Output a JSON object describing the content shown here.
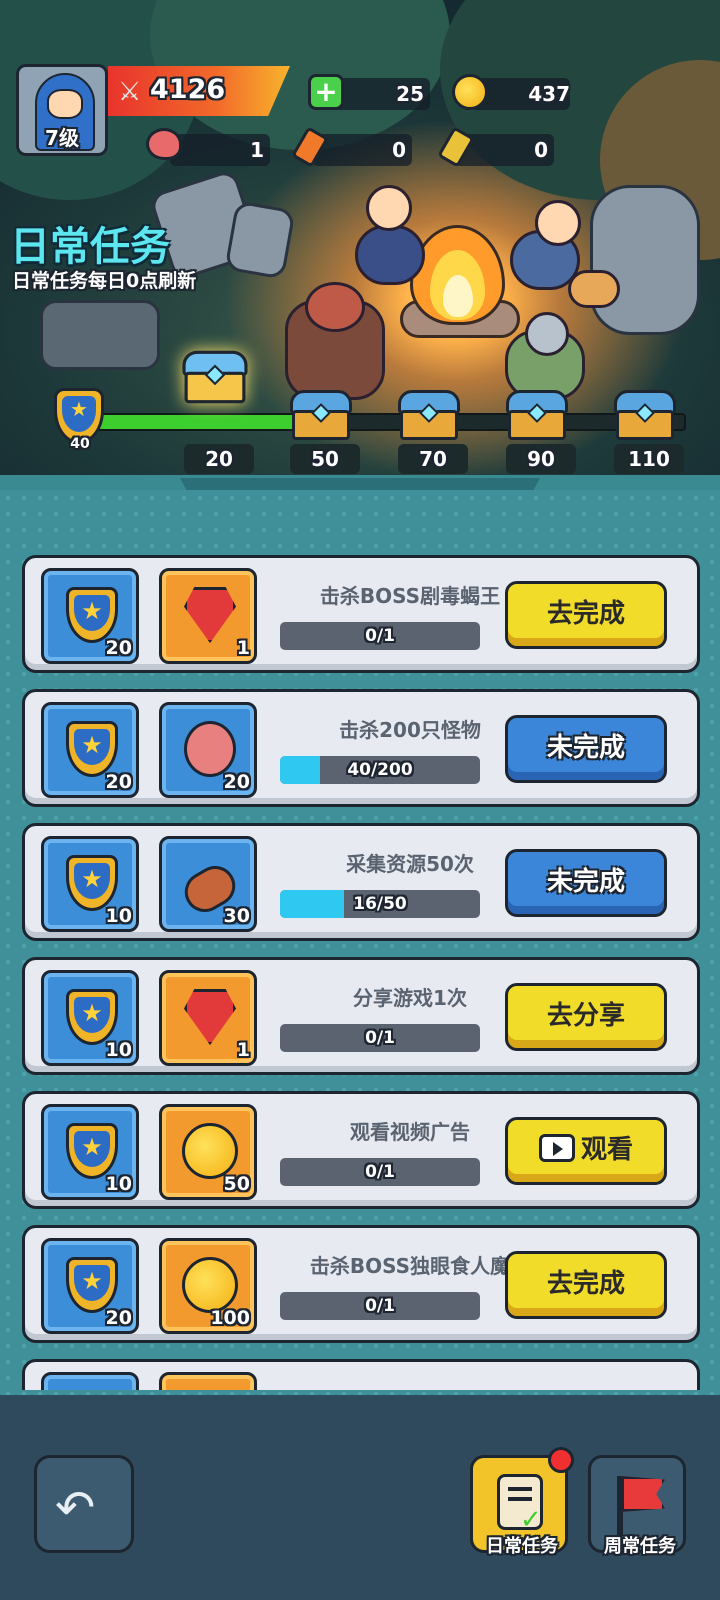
{
  "player": {
    "level_label": "7级",
    "power": "4126"
  },
  "resources": [
    {
      "name": "gem",
      "value": "25"
    },
    {
      "name": "coin",
      "value": "437"
    },
    {
      "name": "meat",
      "value": "1"
    },
    {
      "name": "red-ticket",
      "value": "0"
    },
    {
      "name": "blue-ticket",
      "value": "0"
    }
  ],
  "header": {
    "title": "日常任务",
    "subtitle": "日常任务每日0点刷新"
  },
  "activity": {
    "current": "40",
    "progress_fraction": 0.34,
    "milestones": [
      "20",
      "50",
      "70",
      "90",
      "110"
    ],
    "opened_milestone": "20"
  },
  "tasks": [
    {
      "name": "击杀BOSS剧毒蝎王",
      "reward_points": "20",
      "reward_icon": "red-gem-icon",
      "reward_count": "1",
      "progress": "0/1",
      "progress_fraction": 0,
      "button": "去完成",
      "button_style": "yellow"
    },
    {
      "name": "击杀200只怪物",
      "reward_points": "20",
      "reward_icon": "meat-icon",
      "reward_count": "20",
      "progress": "40/200",
      "progress_fraction": 0.2,
      "button": "未完成",
      "button_style": "blue"
    },
    {
      "name": "采集资源50次",
      "reward_points": "10",
      "reward_icon": "wood-log-icon",
      "reward_count": "30",
      "progress": "16/50",
      "progress_fraction": 0.32,
      "button": "未完成",
      "button_style": "blue"
    },
    {
      "name": "分享游戏1次",
      "reward_points": "10",
      "reward_icon": "red-gem-icon",
      "reward_count": "1",
      "progress": "0/1",
      "progress_fraction": 0,
      "button": "去分享",
      "button_style": "yellow"
    },
    {
      "name": "观看视频广告",
      "reward_points": "10",
      "reward_icon": "gold-coin-icon",
      "reward_count": "50",
      "progress": "0/1",
      "progress_fraction": 0,
      "button": "观看",
      "button_style": "yellow",
      "button_icon": "tv-icon"
    },
    {
      "name": "击杀BOSS独眼食人魔",
      "reward_points": "20",
      "reward_icon": "gold-coin-icon",
      "reward_count": "100",
      "progress": "0/1",
      "progress_fraction": 0,
      "button": "去完成",
      "button_style": "yellow"
    }
  ],
  "nav": {
    "back_icon": "back-arrow-icon",
    "daily_label": "日常任务",
    "weekly_label": "周常任务",
    "daily_has_notification": true
  },
  "colors": {
    "accent_title": "#5be6f0",
    "progress_green": "#3ccf2e",
    "task_progress": "#2fc8f0",
    "button_yellow": "#f2dc2a",
    "button_blue": "#3b86d8"
  }
}
